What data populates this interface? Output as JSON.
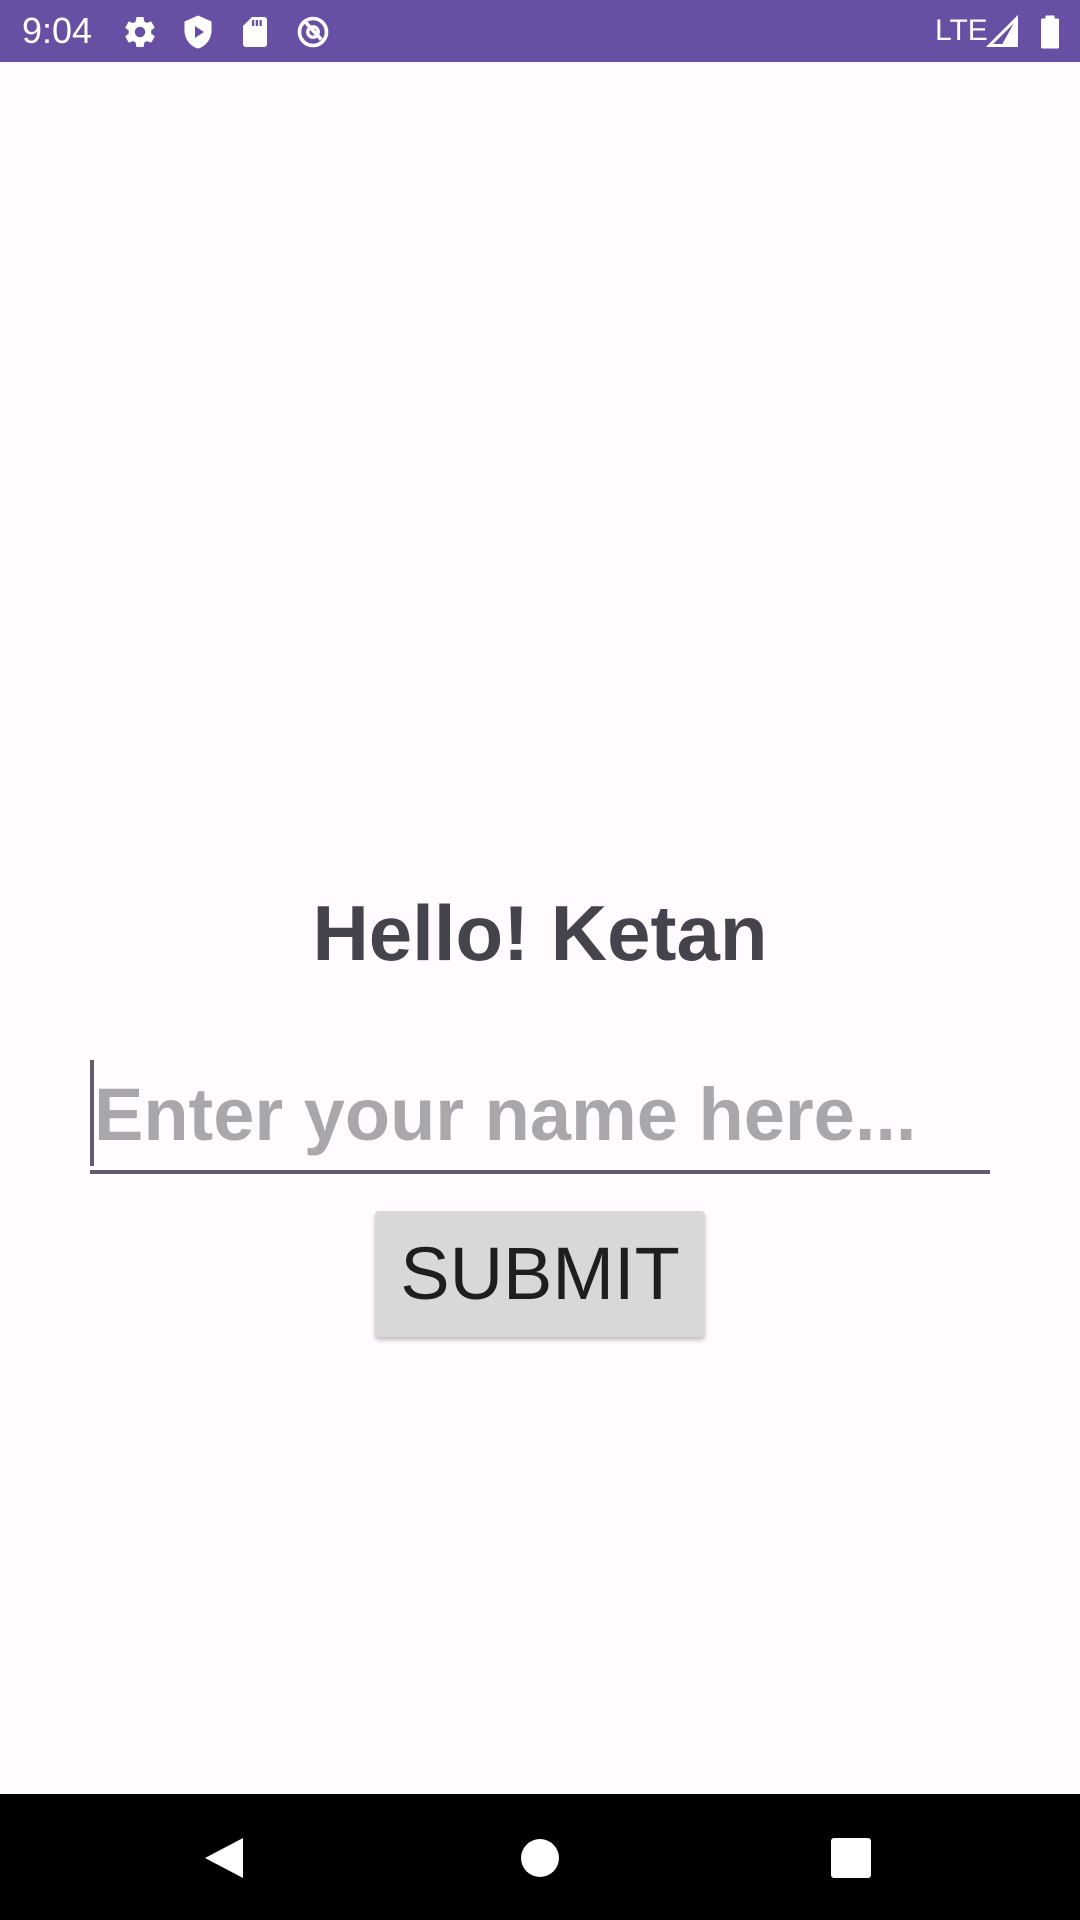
{
  "status_bar": {
    "time": "9:04",
    "network_label": "LTE",
    "icons": [
      "gear-icon",
      "shield-play-icon",
      "sd-card-icon",
      "data-saver-icon",
      "signal-icon",
      "battery-icon"
    ],
    "background_color": "#6750a4"
  },
  "main": {
    "greeting": "Hello! Ketan",
    "name_input": {
      "placeholder": "Enter your name here...",
      "value": ""
    },
    "submit_label": "SUBMIT"
  },
  "nav_bar": {
    "icons": [
      "back-icon",
      "home-icon",
      "recents-icon"
    ]
  }
}
